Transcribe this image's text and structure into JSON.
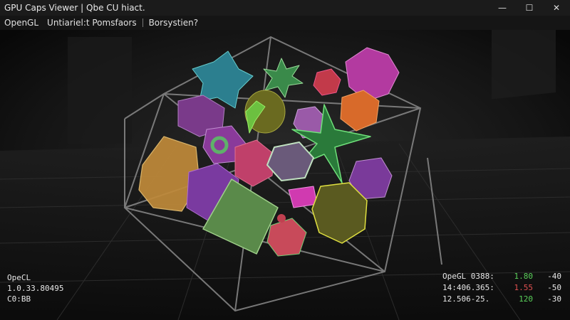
{
  "window": {
    "title": "GPU Caps Viewer | Qbe CU hiact.",
    "controls": {
      "minimize": "—",
      "maximize": "☐",
      "close": "✕"
    }
  },
  "menu": {
    "items": [
      "OpenGL",
      "Untiariel:t Pomsfaors",
      "Borsystien?"
    ]
  },
  "hud_left": {
    "lines": [
      "OpeCL",
      "1.0.33.80495",
      "C0:BB"
    ]
  },
  "hud_right": {
    "rows": [
      {
        "label": "OpeGL 0388:",
        "value": "1.80",
        "value_color": "#5ad05a",
        "extra": "-40"
      },
      {
        "label": "14:406.365:",
        "value": "1.55",
        "value_color": "#e05050",
        "extra": "-50"
      },
      {
        "label": "12.506-25.",
        "value": "120",
        "value_color": "#5ad05a",
        "extra": "-30"
      }
    ]
  },
  "colors": {
    "background": "#0b0b0b",
    "cage_stroke": "#8a8a8a",
    "green_value": "#5ad05a",
    "red_value": "#e05050"
  }
}
